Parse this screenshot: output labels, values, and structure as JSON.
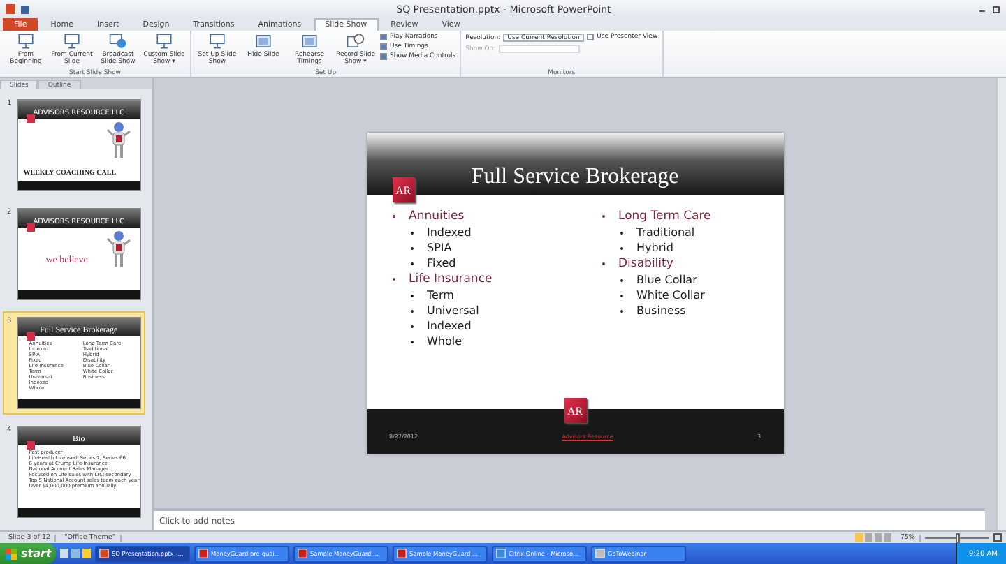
{
  "window": {
    "title": "SQ Presentation.pptx - Microsoft PowerPoint"
  },
  "tabs": [
    {
      "label": "File",
      "kind": "file",
      "selected": false
    },
    {
      "label": "Home",
      "selected": false
    },
    {
      "label": "Insert",
      "selected": false
    },
    {
      "label": "Design",
      "selected": false
    },
    {
      "label": "Transitions",
      "selected": false
    },
    {
      "label": "Animations",
      "selected": false
    },
    {
      "label": "Slide Show",
      "selected": true
    },
    {
      "label": "Review",
      "selected": false
    },
    {
      "label": "View",
      "selected": false
    }
  ],
  "ribbon": {
    "groups": [
      {
        "label": "Start Slide Show",
        "buttons": [
          {
            "label": "From Beginning"
          },
          {
            "label": "From Current Slide"
          },
          {
            "label": "Broadcast Slide Show"
          },
          {
            "label": "Custom Slide Show ▾"
          }
        ]
      },
      {
        "label": "Set Up",
        "buttons": [
          {
            "label": "Set Up Slide Show"
          },
          {
            "label": "Hide Slide"
          },
          {
            "label": "Rehearse Timings"
          },
          {
            "label": "Record Slide Show ▾"
          }
        ],
        "checks": [
          {
            "label": "Play Narrations",
            "checked": true
          },
          {
            "label": "Use Timings",
            "checked": true
          },
          {
            "label": "Show Media Controls",
            "checked": true
          }
        ]
      },
      {
        "label": "Monitors",
        "fields": [
          {
            "label": "Resolution:",
            "value": "Use Current Resolution",
            "disabled": false
          },
          {
            "label": "Show On:",
            "disabled": true
          }
        ],
        "checks": [
          {
            "label": "Use Presenter View",
            "checked": false
          }
        ]
      }
    ]
  },
  "panel_tabs": [
    {
      "label": "Slides",
      "selected": true
    },
    {
      "label": "Outline",
      "selected": false
    }
  ],
  "thumbnails": [
    {
      "number": "1",
      "selected": false,
      "kind": "cover",
      "heading": "ADVISORS RESOURCE LLC",
      "text": "WEEKLY COACHING CALL"
    },
    {
      "number": "2",
      "selected": false,
      "kind": "statement",
      "heading": "ADVISORS RESOURCE LLC",
      "text": "we believe"
    },
    {
      "number": "3",
      "selected": true,
      "kind": "columns",
      "heading": "Full Service Brokerage",
      "columns": [
        [
          "Annuities",
          "Indexed",
          "SPIA",
          "Fixed",
          "Life Insurance",
          "Term",
          "Universal",
          "Indexed",
          "Whole"
        ],
        [
          "Long Term Care",
          "Traditional",
          "Hybrid",
          "Disability",
          "Blue Collar",
          "White Collar",
          "Business"
        ]
      ]
    },
    {
      "number": "4",
      "selected": false,
      "kind": "list",
      "heading": "Bio",
      "lines": [
        "Past producer",
        "LifeHealth Licensed, Series 7, Series 66",
        "6 years at Crump Life Insurance",
        "National Account Sales Manager",
        "Focused on Life sales with LTCI secondary",
        "Top 5 National Account sales team each year",
        "Over $4,000,000 premium annually"
      ]
    }
  ],
  "slide": {
    "title": "Full Service Brokerage",
    "columns": [
      [
        {
          "text": "Annuities",
          "children": [
            {
              "text": "Indexed"
            },
            {
              "text": "SPIA"
            },
            {
              "text": "Fixed"
            }
          ]
        },
        {
          "text": "Life Insurance",
          "children": [
            {
              "text": "Term"
            },
            {
              "text": "Universal"
            },
            {
              "text": "Indexed"
            },
            {
              "text": "Whole"
            }
          ]
        }
      ],
      [
        {
          "text": "Long Term Care",
          "children": [
            {
              "text": "Traditional"
            },
            {
              "text": "Hybrid"
            }
          ]
        },
        {
          "text": "Disability",
          "children": [
            {
              "text": "Blue Collar"
            },
            {
              "text": "White Collar"
            },
            {
              "text": "Business"
            }
          ]
        }
      ]
    ],
    "logo": "AR",
    "footer_logo": "AR",
    "footer": {
      "date": "8/27/2012",
      "center": "Advisors Resource",
      "number": "3"
    }
  },
  "notes": {
    "placeholder": "Click to add notes"
  },
  "status_bar": {
    "slide": "Slide 3 of 12",
    "theme": "\"Office Theme\"",
    "zoom": "75%",
    "level": 0.5
  },
  "taskbar": {
    "start": "start",
    "tasks": [
      {
        "label": "SQ Presentation.pptx -...",
        "selected": true
      },
      {
        "label": "MoneyGuard pre-quai...",
        "selected": false
      },
      {
        "label": "Sample MoneyGuard ...",
        "selected": false
      },
      {
        "label": "Sample MoneyGuard ...",
        "selected": false
      },
      {
        "label": "Citrix Online - Microso...",
        "selected": false
      },
      {
        "label": "GoToWebinar",
        "selected": false
      }
    ],
    "clock": "9:20 AM"
  }
}
